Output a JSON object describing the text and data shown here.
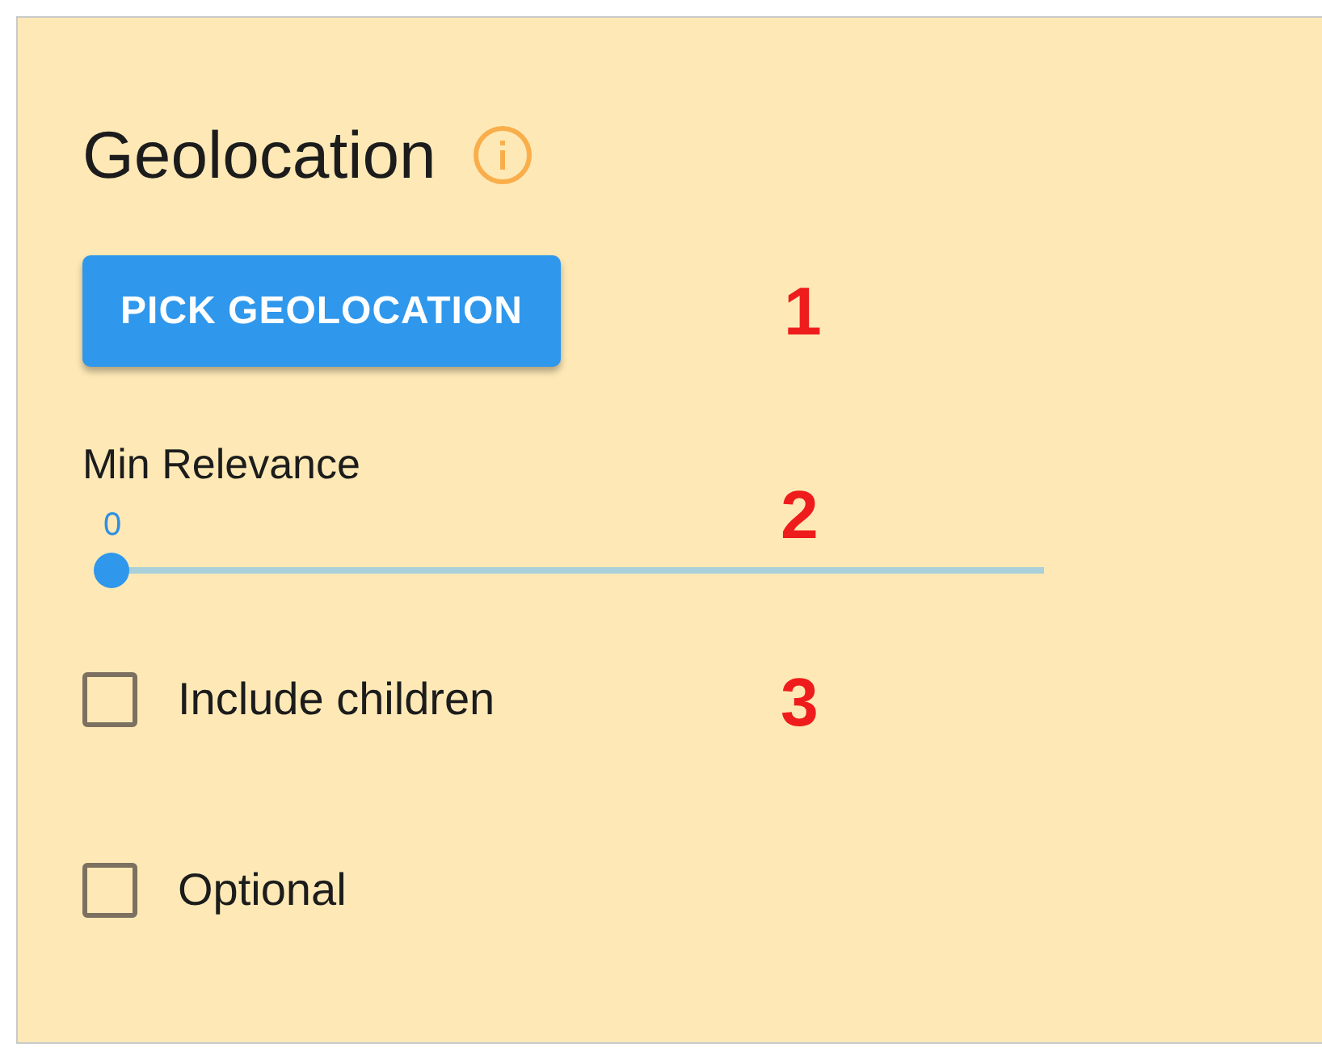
{
  "panel": {
    "title": "Geolocation"
  },
  "button": {
    "label": "PICK GEOLOCATION"
  },
  "slider": {
    "label": "Min Relevance",
    "reading": "0",
    "level": 0
  },
  "checkboxes": [
    {
      "label": "Include children",
      "checked": false
    },
    {
      "label": "Optional",
      "checked": false
    }
  ],
  "annotations": [
    "1",
    "2",
    "3"
  ]
}
